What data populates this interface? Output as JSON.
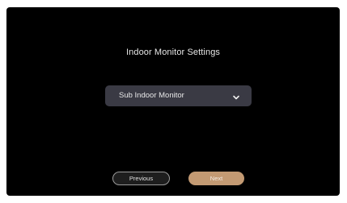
{
  "screen": {
    "title": "Indoor Monitor Settings",
    "monitor_select": {
      "selected": "Sub Indoor Monitor",
      "icon": "chevron-down-icon"
    },
    "buttons": {
      "previous_label": "Previous",
      "next_label": "Next"
    },
    "colors": {
      "background": "#000000",
      "select_bg": "#3a3a44",
      "accent": "#c39a73"
    }
  }
}
